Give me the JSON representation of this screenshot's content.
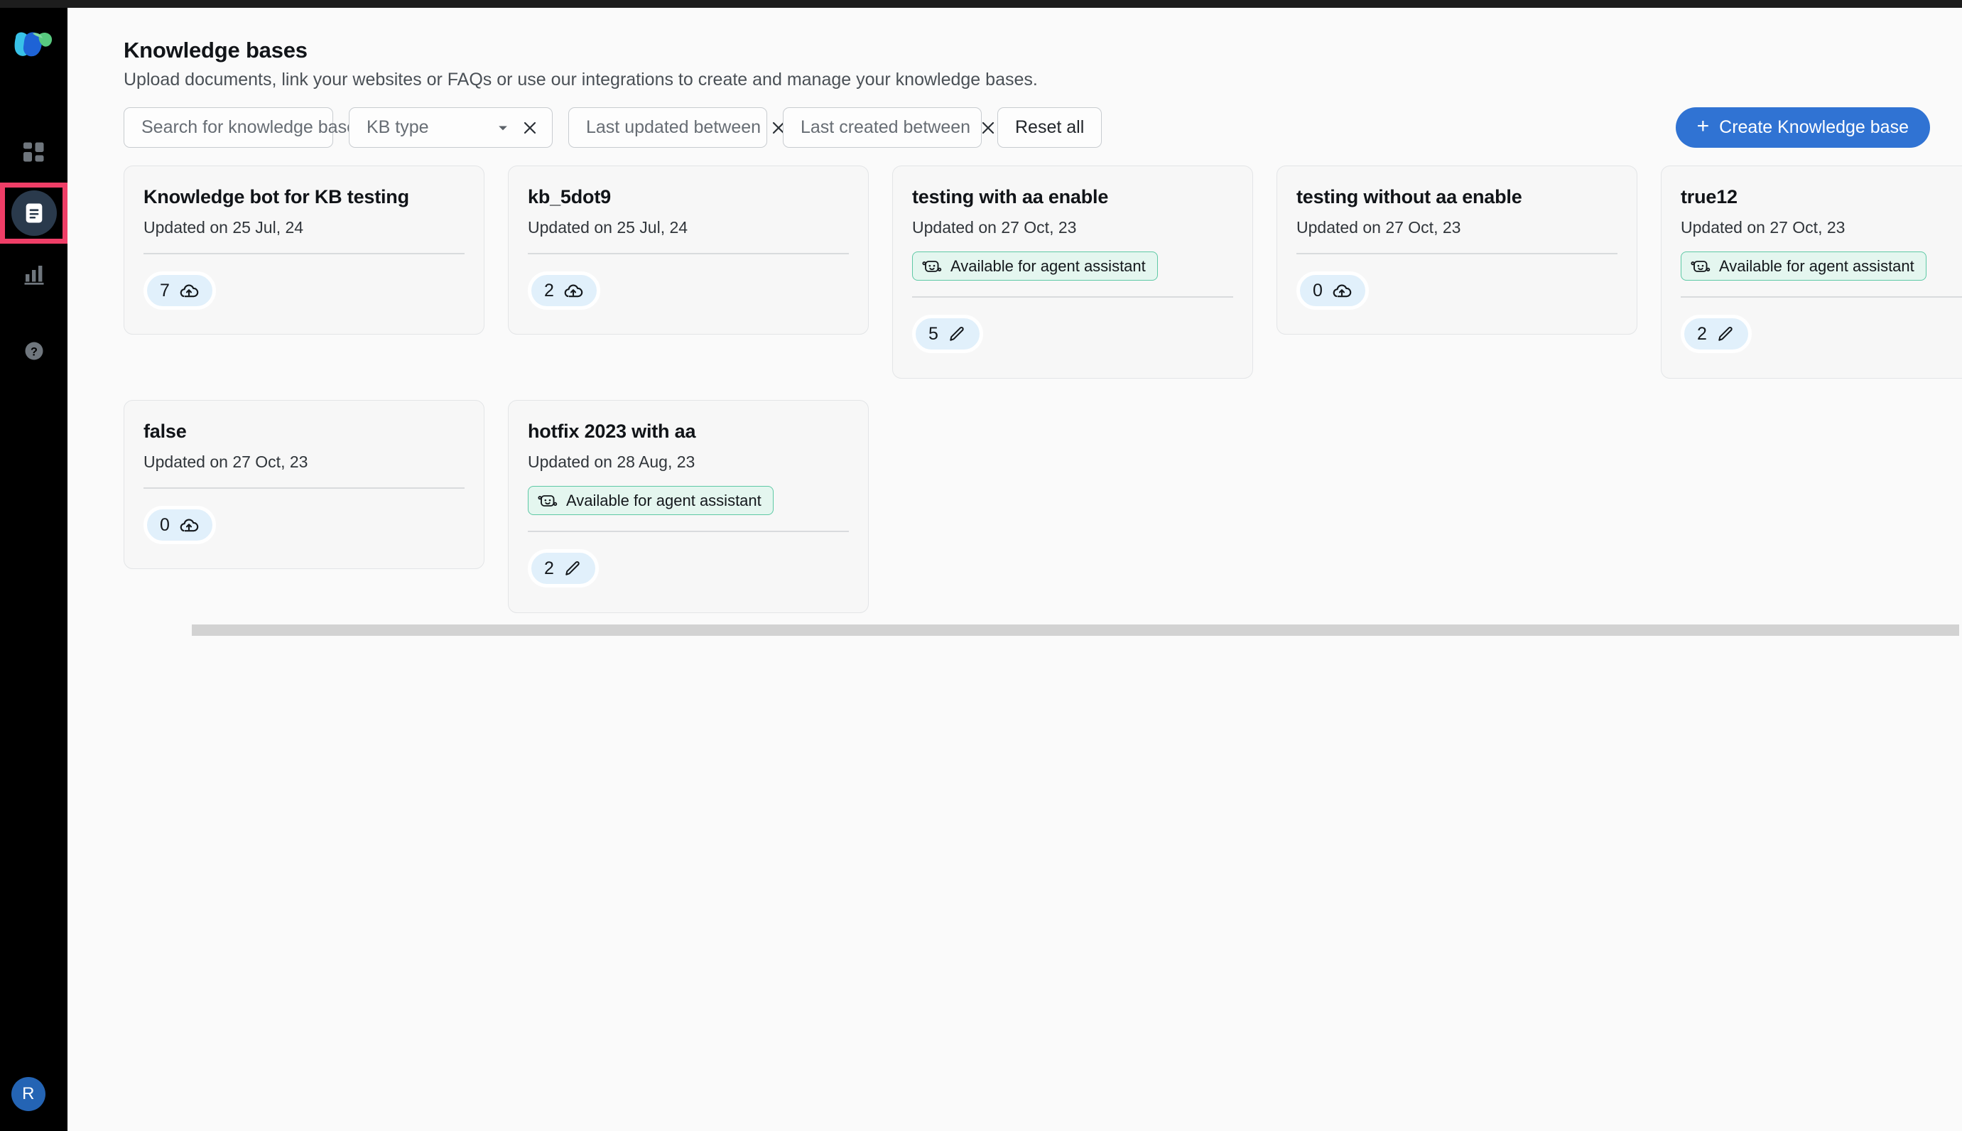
{
  "sidebar": {
    "logo_name": "brand-logo",
    "items": [
      {
        "name": "apps-grid",
        "icon": "grid-icon",
        "selected": false
      },
      {
        "name": "knowledge-bases",
        "icon": "document-icon",
        "selected": true
      },
      {
        "name": "analytics",
        "icon": "bar-chart-icon",
        "selected": false
      },
      {
        "name": "help",
        "icon": "help-circle-icon",
        "selected": false
      }
    ],
    "avatar_initial": "R"
  },
  "header": {
    "title": "Knowledge bases",
    "subtitle": "Upload documents, link your websites or FAQs or use our integrations to create and manage your knowledge bases."
  },
  "filters": {
    "search_placeholder": "Search for knowledge base",
    "kb_type_placeholder": "KB type",
    "last_updated_placeholder": "Last updated between",
    "last_created_placeholder": "Last created between",
    "reset_label": "Reset all"
  },
  "actions": {
    "create_label": "Create Knowledge base",
    "create_plus": "+"
  },
  "labels": {
    "agent_assistant_tag": "Available for agent assistant"
  },
  "colors": {
    "accent_blue": "#3073d3",
    "selection_pink": "#ef3e67",
    "tag_green_border": "#5ec9a5",
    "tag_green_bg": "#e4f6ef",
    "count_bg": "#e1f0fb",
    "rail_black": "#000000",
    "canvas": "#fafafa"
  },
  "cards": [
    {
      "title": "Knowledge bot for KB testing",
      "date": "Updated on 25 Jul, 24",
      "tag": null,
      "count": "7",
      "count_icon": "cloud-upload-icon"
    },
    {
      "title": "kb_5dot9",
      "date": "Updated on 25 Jul, 24",
      "tag": null,
      "count": "2",
      "count_icon": "cloud-upload-icon"
    },
    {
      "title": "testing with aa enable",
      "date": "Updated on 27 Oct, 23",
      "tag": "Available for agent assistant",
      "count": "5",
      "count_icon": "pencil-icon"
    },
    {
      "title": "testing without aa enable",
      "date": "Updated on 27 Oct, 23",
      "tag": null,
      "count": "0",
      "count_icon": "cloud-upload-icon"
    },
    {
      "title": "true12",
      "date": "Updated on 27 Oct, 23",
      "tag": "Available for agent assistant",
      "count": "2",
      "count_icon": "pencil-icon"
    },
    {
      "title": "false",
      "date": "Updated on 27 Oct, 23",
      "tag": null,
      "count": "0",
      "count_icon": "cloud-upload-icon"
    },
    {
      "title": "hotfix 2023 with aa",
      "date": "Updated on 28 Aug, 23",
      "tag": "Available for agent assistant",
      "count": "2",
      "count_icon": "pencil-icon"
    }
  ]
}
